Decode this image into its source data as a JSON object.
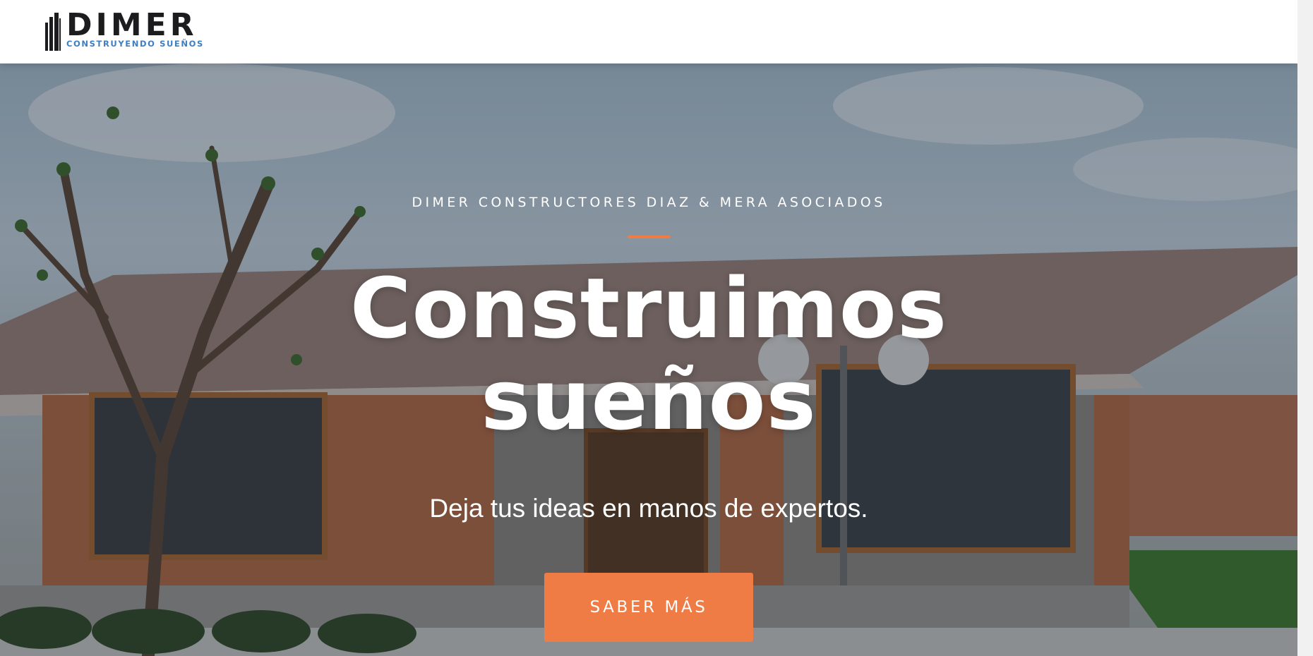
{
  "brand": {
    "name": "DIMER",
    "tagline": "CONSTRUYENDO SUEÑOS"
  },
  "hero": {
    "kicker": "DIMER CONSTRUCTORES DIAZ & MERA ASOCIADOS",
    "title_line1": "Construimos",
    "title_line2": "sueños",
    "subtitle": "Deja tus ideas en manos de expertos.",
    "cta_label": "SABER MÁS",
    "image": "house-rendering-background"
  },
  "colors": {
    "accent": "#ef7b45",
    "logo_tagline": "#3e7ec4",
    "logo_text": "#1c1c1e"
  }
}
